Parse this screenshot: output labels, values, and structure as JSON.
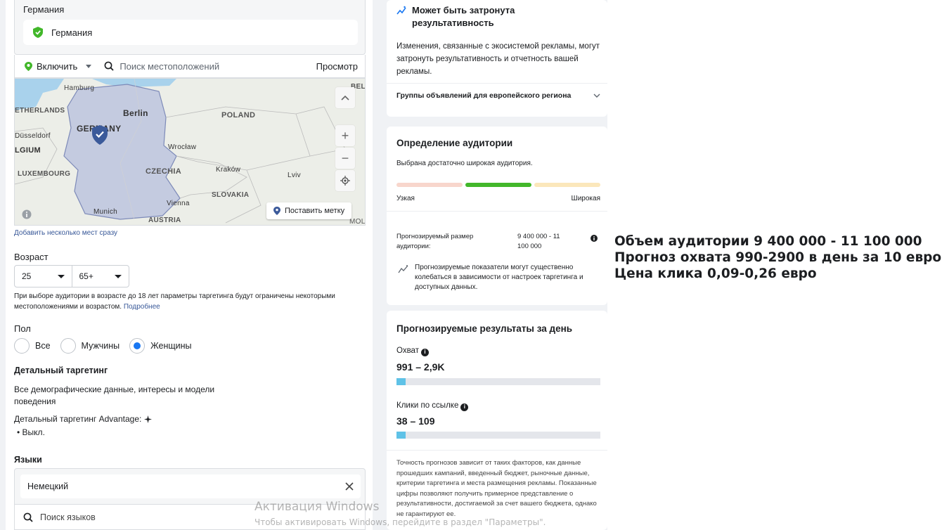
{
  "location": {
    "region": "Германия",
    "chip": "Германия",
    "include_label": "Включить",
    "search_placeholder": "Поиск местоположений",
    "browse": "Просмотр"
  },
  "map": {
    "labels": [
      "Hamburg",
      "BEL",
      "ETHERLANDS",
      "Berlin",
      "POLAND",
      "Düsseldorf",
      "GERMANY",
      "LGIUM",
      "Wrocław",
      "LUXEMBOURG",
      "CZECHIA",
      "Kraków",
      "Lviv",
      "SLOVAKIA",
      "Vienna",
      "Munich",
      "AUSTRIA",
      "MOL"
    ],
    "drop_pin": "Поставить метку"
  },
  "add_multiple_link": "Добавить несколько мест сразу",
  "age": {
    "label": "Возраст",
    "min": "25",
    "max": "65+",
    "note": "При выборе аудитории в возрасте до 18 лет параметры таргетинга будут ограничены некоторыми местоположениями и возрастом.",
    "note_link": "Подробнее"
  },
  "gender": {
    "label": "Пол",
    "options": [
      "Все",
      "Мужчины",
      "Женщины"
    ],
    "selected": "Женщины"
  },
  "detailed": {
    "title": "Детальный таргетинг",
    "desc": "Все демографические данные, интересы и модели поведения",
    "advantage": "Детальный таргетинг Advantage:",
    "advantage_state": "Выкл."
  },
  "languages": {
    "title": "Языки",
    "chip": "Немецкий",
    "search_placeholder": "Поиск языков"
  },
  "card1": {
    "title": "Может быть затронута результативность",
    "text": "Изменения, связанные с экосистемой рекламы, могут затронуть результативность и отчетность вашей рекламы.",
    "dropdown": "Группы объявлений для европейского региона"
  },
  "card2": {
    "title": "Определение аудитории",
    "subtitle": "Выбрана достаточно широкая аудитория.",
    "narrow": "Узкая",
    "wide": "Широкая",
    "meter_position": "middle",
    "size_label": "Прогнозируемый размер аудитории:",
    "size_value": "9 400 000 - 11 100 000",
    "disclaimer": "Прогнозируемые показатели могут существенно колебаться в зависимости от настроек таргетинга и доступных данных."
  },
  "card3": {
    "title": "Прогнозируемые результаты за день",
    "reach_label": "Охват",
    "reach_value": "991 – 2,9K",
    "reach_fill": 0.045,
    "clicks_label": "Клики по ссылке",
    "clicks_value": "38 – 109",
    "clicks_fill": 0.045,
    "footnote": "Точность прогнозов зависит от таких факторов, как данные прошедших кампаний, введенный бюджет, рыночные данные, критерии таргетинга и места размещения рекламы. Показанные цифры позволяют получить примерное представление о результативности, достигаемой за счет вашего бюджета, однако не гарантируют ее."
  },
  "annotation": {
    "line1": "Объем аудитории 9 400 000 - 11 100 000",
    "line2": "Прогноз охвата 990-2900 в день за 10 евро",
    "line3": "Цена клика 0,09-0,26 евро"
  },
  "watermark": {
    "line1": "Активация Windows",
    "line2": "Чтобы активировать Windows, перейдите в раздел \"Параметры\"."
  },
  "colors": {
    "accent_blue": "#1877f2",
    "green": "#42b72a",
    "bar_fill": "#5fc2e7"
  }
}
